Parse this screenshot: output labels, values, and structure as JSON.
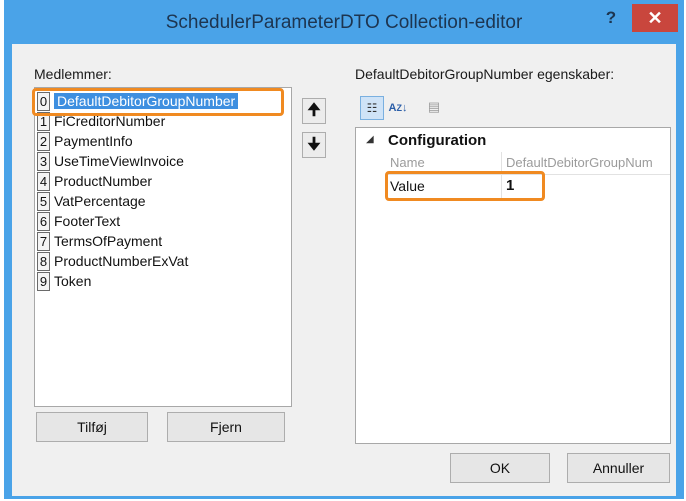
{
  "window": {
    "title": "SchedulerParameterDTO Collection-editor",
    "help": "?",
    "close": "✕"
  },
  "members": {
    "label": "Medlemmer:",
    "items": [
      {
        "index": "0",
        "name": "DefaultDebitorGroupNumber",
        "selected": true
      },
      {
        "index": "1",
        "name": "FiCreditorNumber"
      },
      {
        "index": "2",
        "name": "PaymentInfo"
      },
      {
        "index": "3",
        "name": "UseTimeViewInvoice"
      },
      {
        "index": "4",
        "name": "ProductNumber"
      },
      {
        "index": "5",
        "name": "VatPercentage"
      },
      {
        "index": "6",
        "name": "FooterText"
      },
      {
        "index": "7",
        "name": "TermsOfPayment"
      },
      {
        "index": "8",
        "name": "ProductNumberExVat"
      },
      {
        "index": "9",
        "name": "Token"
      }
    ],
    "add_button": "Tilføj",
    "remove_button": "Fjern"
  },
  "properties": {
    "label": "DefaultDebitorGroupNumber egenskaber:",
    "category": "Configuration",
    "rows": [
      {
        "name": "Name",
        "value": "DefaultDebitorGroupNum",
        "readonly": true
      },
      {
        "name": "Value",
        "value": "1",
        "readonly": false
      }
    ]
  },
  "footer": {
    "ok": "OK",
    "cancel": "Annuller"
  },
  "colors": {
    "title_bar": "#4aa3e8",
    "close_button": "#c9463d",
    "selection": "#3e8fe0",
    "highlight": "#f08a21"
  }
}
